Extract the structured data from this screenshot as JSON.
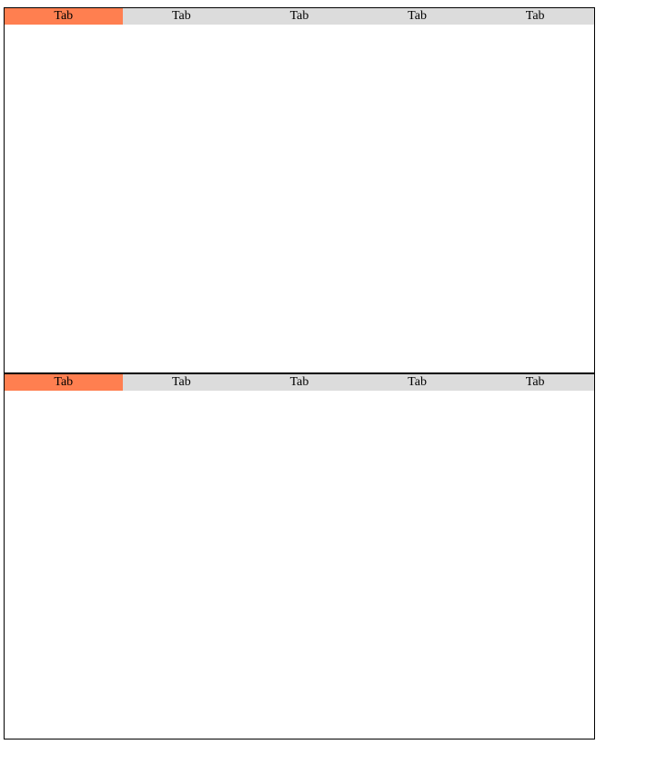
{
  "colors": {
    "active_tab": "#ff7f50",
    "inactive_tab": "#dcdcdc",
    "border": "#000000",
    "background": "#ffffff"
  },
  "top_panel": {
    "active_index": 0,
    "tabs": [
      {
        "label": "Tab"
      },
      {
        "label": "Tab"
      },
      {
        "label": "Tab"
      },
      {
        "label": "Tab"
      },
      {
        "label": "Tab"
      }
    ]
  },
  "bottom_panel": {
    "active_index": 0,
    "tabs": [
      {
        "label": "Tab"
      },
      {
        "label": "Tab"
      },
      {
        "label": "Tab"
      },
      {
        "label": "Tab"
      },
      {
        "label": "Tab"
      }
    ]
  }
}
